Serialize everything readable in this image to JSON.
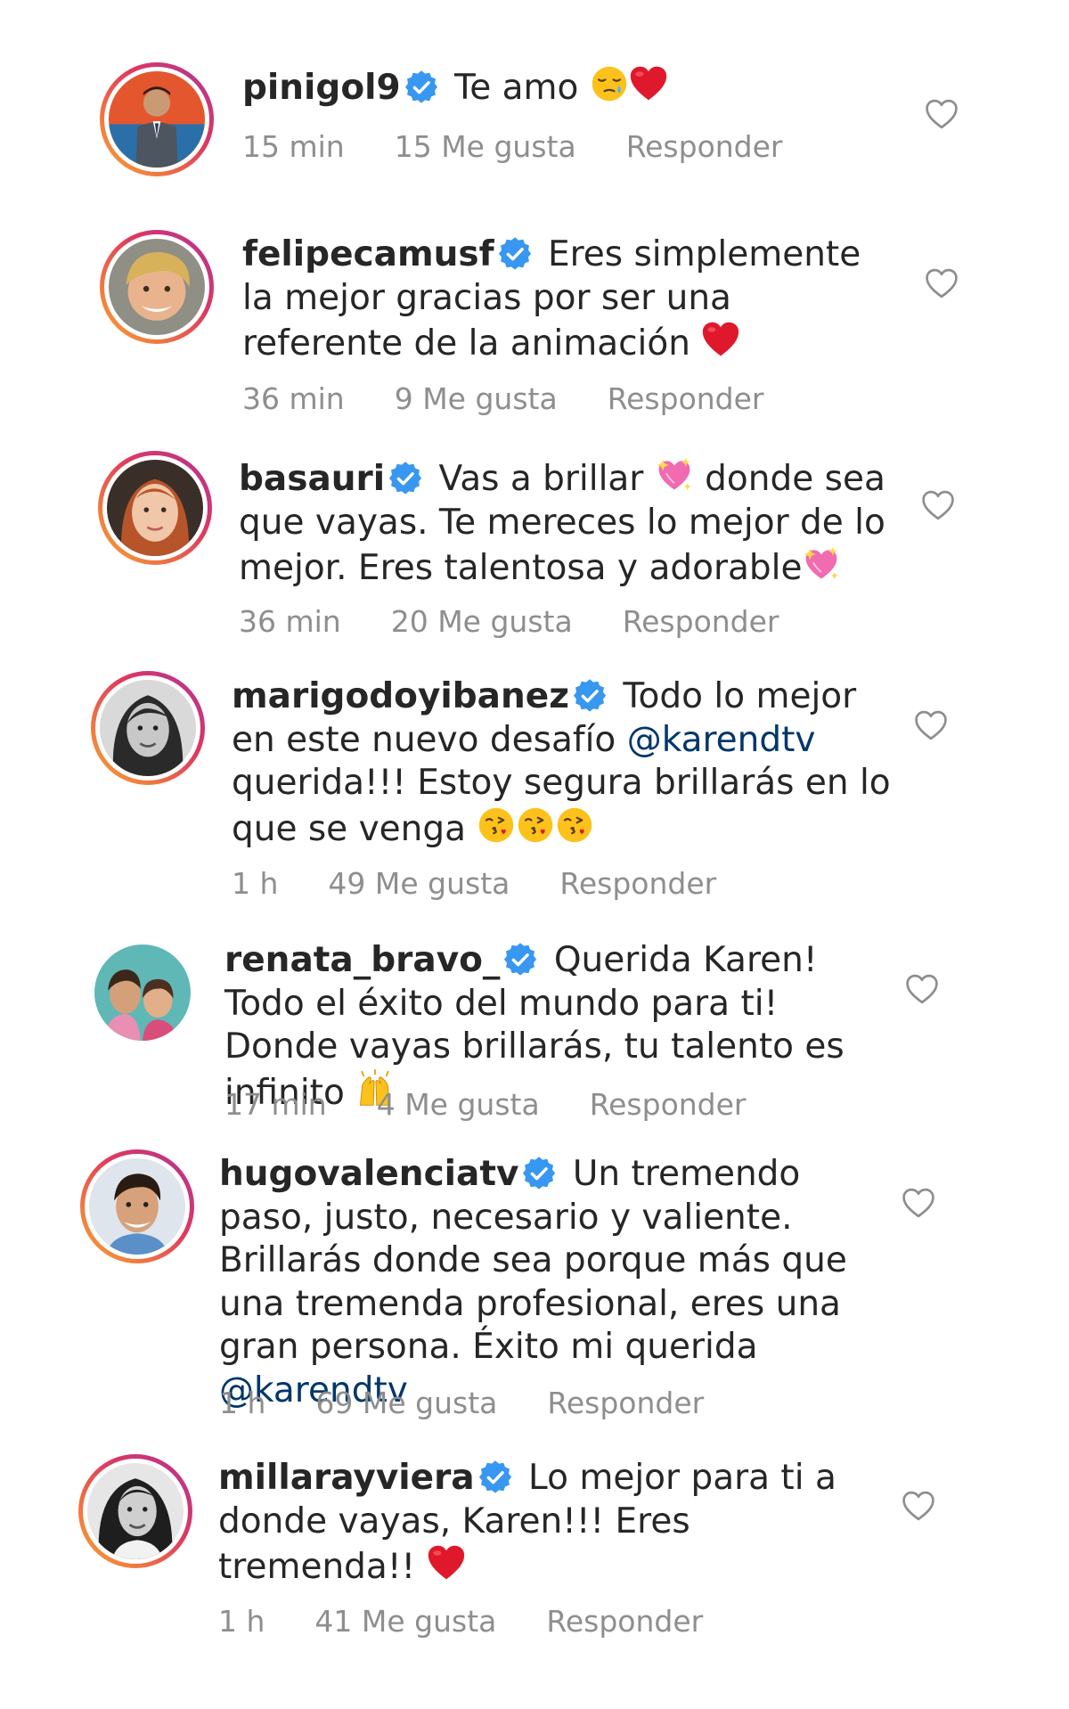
{
  "comments": [
    {
      "username": "pinigol9",
      "verified": true,
      "text": "Te amo",
      "emojis": [
        "sleepy-face",
        "red-heart"
      ],
      "time": "15 min",
      "likes": "15 Me gusta",
      "reply": "Responder",
      "avatar_ring": true
    },
    {
      "username": "felipecamusf",
      "verified": true,
      "text": "Eres simplemente la mejor gracias por ser una referente de la animación",
      "emojis": [
        "red-heart"
      ],
      "time": "36 min",
      "likes": "9 Me gusta",
      "reply": "Responder",
      "avatar_ring": true
    },
    {
      "username": "basauri",
      "verified": true,
      "text_parts": [
        "Vas a brillar",
        "donde sea que vayas. Te mereces lo mejor de lo mejor. Eres talentosa y adorable"
      ],
      "emojis": [
        "sparkling-heart",
        "sparkling-heart"
      ],
      "time": "36 min",
      "likes": "20 Me gusta",
      "reply": "Responder",
      "avatar_ring": true
    },
    {
      "username": "marigodoyibanez",
      "verified": true,
      "text_parts": [
        "Todo lo mejor en este nuevo desafío",
        "@karendtv",
        "querida!!! Estoy segura brillarás en lo que se venga"
      ],
      "emojis": [
        "kissing-face",
        "kissing-face",
        "kissing-face"
      ],
      "time": "1 h",
      "likes": "49 Me gusta",
      "reply": "Responder",
      "avatar_ring": true
    },
    {
      "username": "renata_bravo_",
      "verified": true,
      "text": "Querida Karen! Todo el éxito del mundo para ti! Donde vayas brillarás, tu talento es infinito",
      "emojis": [
        "raising-hands"
      ],
      "time": "17 min",
      "likes": "4 Me gusta",
      "reply": "Responder",
      "avatar_ring": false
    },
    {
      "username": "hugovalenciatv",
      "verified": true,
      "text_parts": [
        "Un tremendo paso, justo, necesario y valiente. Brillarás donde sea porque más que una tremenda profesional, eres una gran persona. Éxito mi querida",
        "@karendtv"
      ],
      "emojis": [],
      "time": "1 h",
      "likes": "69 Me gusta",
      "reply": "Responder",
      "avatar_ring": true
    },
    {
      "username": "millarayviera",
      "verified": true,
      "text": "Lo mejor para ti a donde vayas, Karen!!! Eres tremenda!!",
      "emojis": [
        "red-heart"
      ],
      "time": "1 h",
      "likes": "41 Me gusta",
      "reply": "Responder",
      "avatar_ring": true
    }
  ],
  "colors": {
    "text": "#262626",
    "meta": "#8e8e8e",
    "mention": "#00376b",
    "verified": "#3897f0",
    "heart_outline": "#8e8e8e"
  }
}
